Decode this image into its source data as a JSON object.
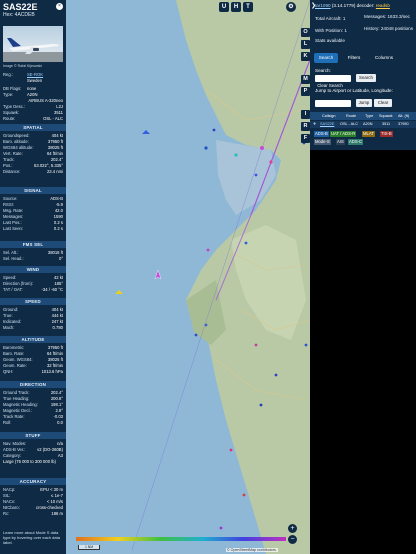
{
  "info": {
    "callsign": "SAS22E",
    "hex": "Hex: 4ACDEB",
    "close_symbol": "×",
    "credit": "Image © Rafal Kijeowski",
    "reg_label": "Reg.:",
    "reg": "SE-ROK",
    "country": "Sweden",
    "db_flags_label": "DB Flags:",
    "db_flags": "none",
    "type_label": "Type:",
    "type": "A20N",
    "type_full": "AIRBUS A-320neo",
    "type_desc_label": "Type Desc.:",
    "type_desc": "L2J",
    "squawk_label": "Squawk:",
    "squawk": "3511",
    "route_label": "Route:",
    "route": "OSL - ALC",
    "spatial_title": "SPATIAL",
    "spatial": [
      {
        "k": "Groundspeed:",
        "v": "404 kt"
      },
      {
        "k": "Baro. altitude:",
        "v": "37950 ft"
      },
      {
        "k": "WGS84 altitude:",
        "v": "38025 ft"
      },
      {
        "k": "Vert. Rate:",
        "v": "64 ft/min"
      },
      {
        "k": "Track:",
        "v": "202.4°"
      },
      {
        "k": "Pos.:",
        "v": "53.022°, 5.335°"
      },
      {
        "k": "Distance:",
        "v": "23.4 nmi"
      }
    ],
    "signal_title": "SIGNAL",
    "signal": [
      {
        "k": "Source:",
        "v": "ADS-B"
      },
      {
        "k": "RSSI:",
        "v": "-5.9"
      },
      {
        "k": "Msg. Rate:",
        "v": "42.0"
      },
      {
        "k": "Messages:",
        "v": "1590"
      },
      {
        "k": "Last Pos.:",
        "v": "0.2 s"
      },
      {
        "k": "Last Seen:",
        "v": "0.2 s"
      }
    ],
    "fms_title": "FMS SEL",
    "fms": [
      {
        "k": "Sel. Alt.:",
        "v": "38016 ft"
      },
      {
        "k": "Sel. Head.:",
        "v": "0°"
      }
    ],
    "wind_title": "WIND",
    "wind": [
      {
        "k": "Speed:",
        "v": "42 kt"
      },
      {
        "k": "Direction (from):",
        "v": "185°"
      },
      {
        "k": "TAT / OAT:",
        "v": "-34 / -60 °C"
      }
    ],
    "speed_title": "SPEED",
    "speed": [
      {
        "k": "Ground:",
        "v": "404 kt"
      },
      {
        "k": "True:",
        "v": "444 kt"
      },
      {
        "k": "Indicated:",
        "v": "247 kt"
      },
      {
        "k": "Mach:",
        "v": "0.780"
      }
    ],
    "altitude_title": "ALTITUDE",
    "altitude": [
      {
        "k": "Barometric:",
        "v": "37950 ft"
      },
      {
        "k": "Baro. Rate:",
        "v": "64 ft/min"
      },
      {
        "k": "Geom. WGS84:",
        "v": "38025 ft"
      },
      {
        "k": "Geom. Rate:",
        "v": "32 ft/min"
      },
      {
        "k": "QNH:",
        "v": "1013.6 hPa"
      }
    ],
    "direction_title": "DIRECTION",
    "direction": [
      {
        "k": "Ground Track:",
        "v": "202.4°"
      },
      {
        "k": "True Heading:",
        "v": "200.8°"
      },
      {
        "k": "Magnetic Heading:",
        "v": "198.1°"
      },
      {
        "k": "Magnetic Decl.:",
        "v": "2.8°"
      },
      {
        "k": "Track Rate:",
        "v": "-0.03"
      },
      {
        "k": "Roll:",
        "v": "0.0"
      }
    ],
    "stuff_title": "STUFF",
    "stuff": [
      {
        "k": "Nav. Modes:",
        "v": "n/a"
      },
      {
        "k": "ADS-B Ver.:",
        "v": "v2 (DO-260B)"
      },
      {
        "k": "Category:",
        "v": "A3"
      }
    ],
    "category_desc": "Large (75 000 to 300 000 lb)",
    "accuracy_title": "ACCURACY",
    "accuracy": [
      {
        "k": "NACp:",
        "v": "EPU < 30 m"
      },
      {
        "k": "SIL:",
        "v": "≤ 1e-7"
      },
      {
        "k": "NACv:",
        "v": "< 10 m/s"
      },
      {
        "k": "NICbaro:",
        "v": "cross-checked"
      },
      {
        "k": "Rc:",
        "v": "186 m"
      }
    ],
    "footer": "Learn more about Mode S data type by hovering over each data label."
  },
  "map": {
    "top_buttons": [
      "U",
      "H",
      "T"
    ],
    "side_buttons": [
      "O",
      "L",
      "K",
      "M",
      "P",
      "I",
      "R",
      "F"
    ],
    "zoom_in": "+",
    "zoom_out": "−",
    "scale": "1 NM",
    "attribution": "© OpenStreetMap contributors.",
    "track_color": "#a25bd6",
    "selected_plane_color": "#c54dd6",
    "water_color": "#8fb8d6",
    "land_color": "#b9c9a5"
  },
  "right": {
    "collapse": "❯",
    "version_prefix": "tar1090",
    "version": "(3.14.1779)",
    "decoder_label": "decoder:",
    "decoder": "readsb",
    "total_aircraft": "Total Aircraft: 1",
    "messages": "Messages: 1633.3/sec",
    "with_position": "With Position: 1",
    "history": "History: 24048 positions",
    "stats_available": "Stats available",
    "tabs": [
      "Search",
      "Filters",
      "Columns"
    ],
    "search_label": "Search:",
    "search_button": "Search",
    "clear_search": "Clear Search",
    "jump_label": "Jump to Airport or Latitude, Longitude:",
    "jump_button": "Jump",
    "clear_button": "Clear",
    "columns": [
      "Callsign",
      "Route",
      "Type",
      "Squawk",
      "Alt. (ft)"
    ],
    "rows": [
      {
        "callsign": "SAS22E",
        "route": "OSL - ALC",
        "type": "A20N",
        "squawk": "3511",
        "alt": "37950"
      }
    ],
    "legend": [
      {
        "label": "ADS-B",
        "color": "#1f5fa0"
      },
      {
        "label": "UAT / ADS-R",
        "color": "#2a7d2a"
      },
      {
        "label": "MLAT",
        "color": "#8c6a12"
      },
      {
        "label": "TIS-B",
        "color": "#9a2b2b"
      },
      {
        "label": "Mode-S",
        "color": "#455a70"
      },
      {
        "label": "AIS",
        "color": "#2b3f55"
      },
      {
        "label": "ADS-C",
        "color": "#2f7a6a"
      }
    ]
  }
}
